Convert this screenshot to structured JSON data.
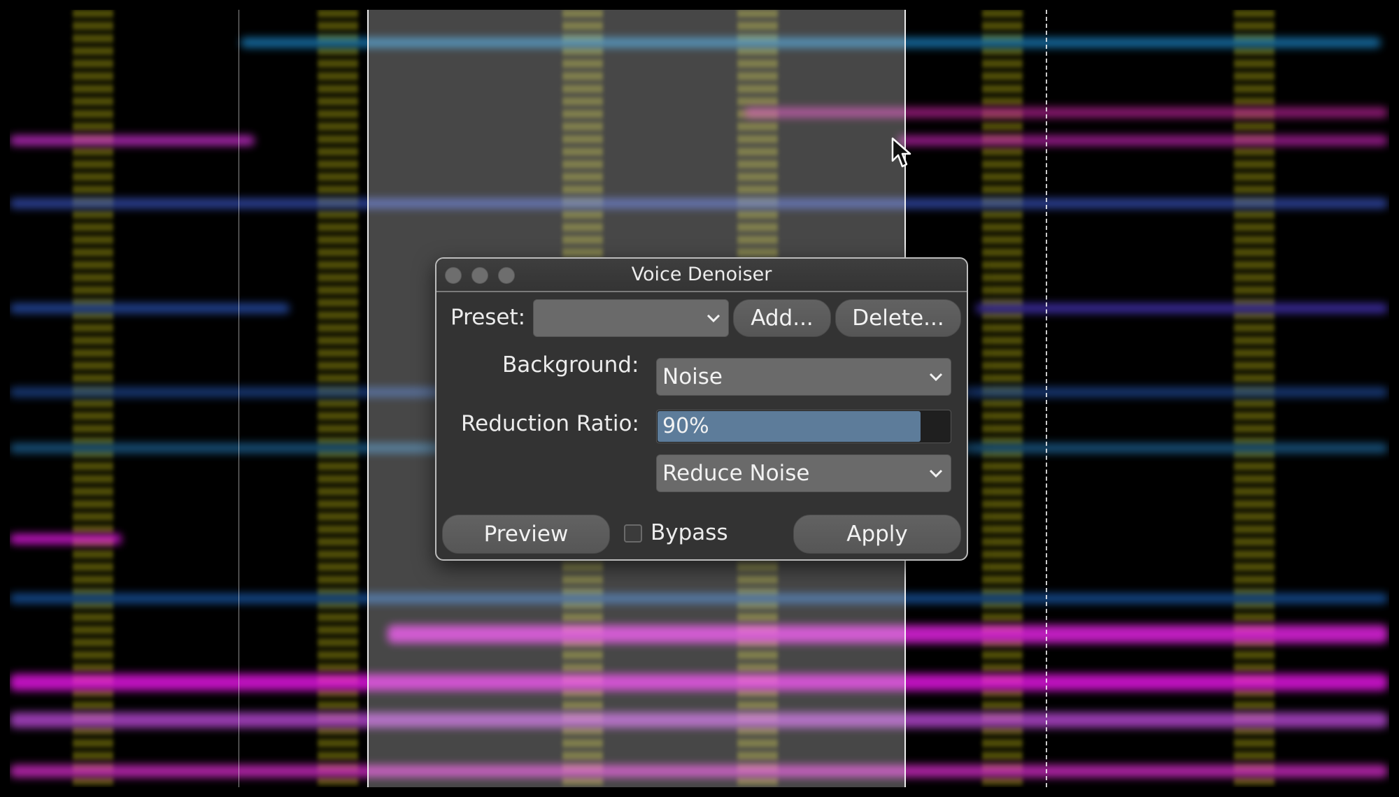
{
  "dialog": {
    "title": "Voice Denoiser",
    "preset_label": "Preset:",
    "preset_value": "",
    "add_button": "Add...",
    "delete_button": "Delete...",
    "background_label": "Background:",
    "background_value": "Noise",
    "reduction_label": "Reduction Ratio:",
    "reduction_value_text": "90%",
    "reduction_value": 90,
    "mode_value": "Reduce Noise",
    "preview_button": "Preview",
    "bypass_label": "Bypass",
    "bypass_checked": false,
    "apply_button": "Apply"
  },
  "colors": {
    "slider_fill": "#5d7c9a",
    "dialog_bg": "#333333",
    "button_bg": "#5c5c5c"
  },
  "icons": [
    "close-icon",
    "minimize-icon",
    "zoom-icon",
    "chevron-down-icon",
    "mouse-pointer-icon"
  ]
}
